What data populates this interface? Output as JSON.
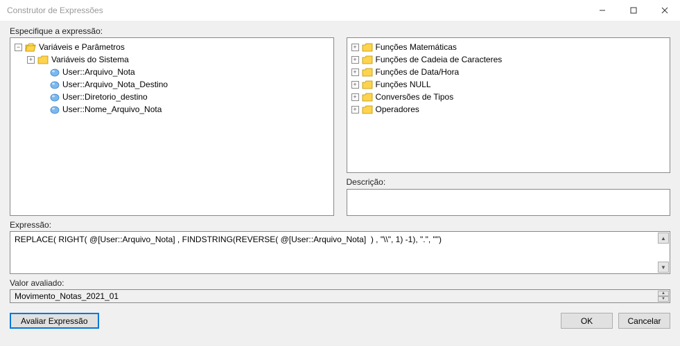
{
  "window": {
    "title": "Construtor de Expressões"
  },
  "labels": {
    "specify": "Especifique a expressão:",
    "description": "Descrição:",
    "expression": "Expressão:",
    "evaluated": "Valor avaliado:"
  },
  "leftTree": {
    "root": "Variáveis e Parâmetros",
    "systemVars": "Variáveis do Sistema",
    "vars": [
      "User::Arquivo_Nota",
      "User::Arquivo_Nota_Destino",
      "User::Diretorio_destino",
      "User::Nome_Arquivo_Nota"
    ]
  },
  "rightTree": {
    "categories": [
      "Funções Matemáticas",
      "Funções de Cadeia de Caracteres",
      "Funções de Data/Hora",
      "Funções NULL",
      "Conversões de Tipos",
      "Operadores"
    ]
  },
  "expression": "REPLACE( RIGHT( @[User::Arquivo_Nota] , FINDSTRING(REVERSE( @[User::Arquivo_Nota]  ) , \"\\\\\", 1) -1), \".\", \"\")",
  "evaluated": "Movimento_Notas_2021_01",
  "buttons": {
    "evaluate": "Avaliar Expressão",
    "ok": "OK",
    "cancel": "Cancelar"
  }
}
